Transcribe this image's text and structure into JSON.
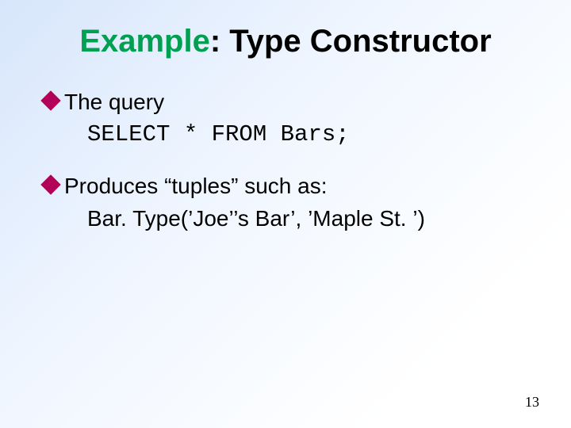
{
  "title": {
    "accent": "Example",
    "rest": ": Type Constructor"
  },
  "bullets": {
    "b1": "The query",
    "b1_sub": "SELECT * FROM Bars;",
    "b2": "Produces “tuples” such as:",
    "b2_sub": "Bar. Type(’Joe’’s Bar’, ’Maple St. ’)"
  },
  "page_number": "13"
}
